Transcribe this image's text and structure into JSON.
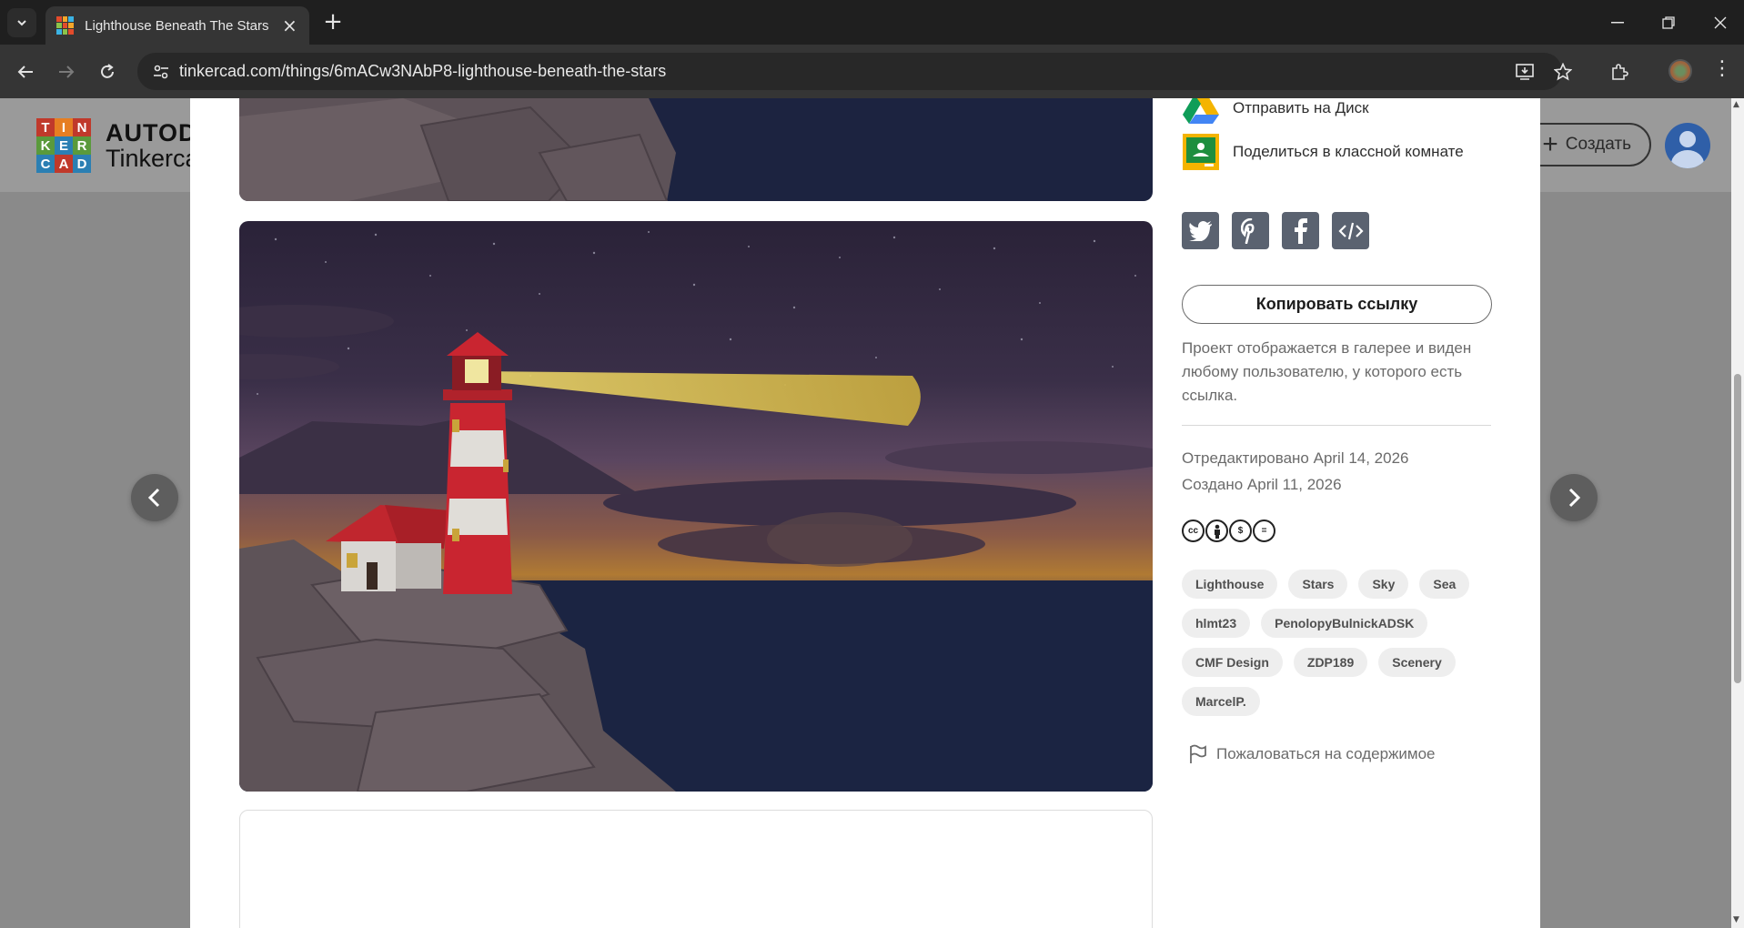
{
  "browser": {
    "tab_title": "Lighthouse Beneath The Stars –",
    "url": "tinkercad.com/things/6mACw3NAbP8-lighthouse-beneath-the-stars"
  },
  "header": {
    "logo_letters": [
      "T",
      "I",
      "N",
      "K",
      "E",
      "R",
      "C",
      "A",
      "D"
    ],
    "brand_line1": "AUTOD",
    "brand_line2": "Tinkerca",
    "create_label": "Создать"
  },
  "sidebar": {
    "share_drive": "Отправить на Диск",
    "share_classroom": "Поделиться в классной комнате",
    "social_icons": [
      "twitter-icon",
      "pinterest-icon",
      "facebook-icon",
      "embed-code-icon"
    ],
    "copy_link": "Копировать ссылку",
    "gallery_note": "Проект отображается в галерее и виден любому пользователю, у которого есть ссылка.",
    "edited": "Отредактировано April 14, 2026",
    "created": "Создано April 11, 2026",
    "license_icons": [
      "cc-icon",
      "by-icon",
      "nc-icon",
      "nd-icon"
    ],
    "tags": [
      "Lighthouse",
      "Stars",
      "Sky",
      "Sea",
      "hlmt23",
      "PenolopyBulnickADSK",
      "CMF Design",
      "ZDP189",
      "Scenery",
      "MarcelP."
    ],
    "report": "Пожаловаться на содержимое"
  },
  "colors": {
    "overlay": "#8a8a8a",
    "accent_blue": "#2f5fa8",
    "social_grey": "#5a6270"
  }
}
